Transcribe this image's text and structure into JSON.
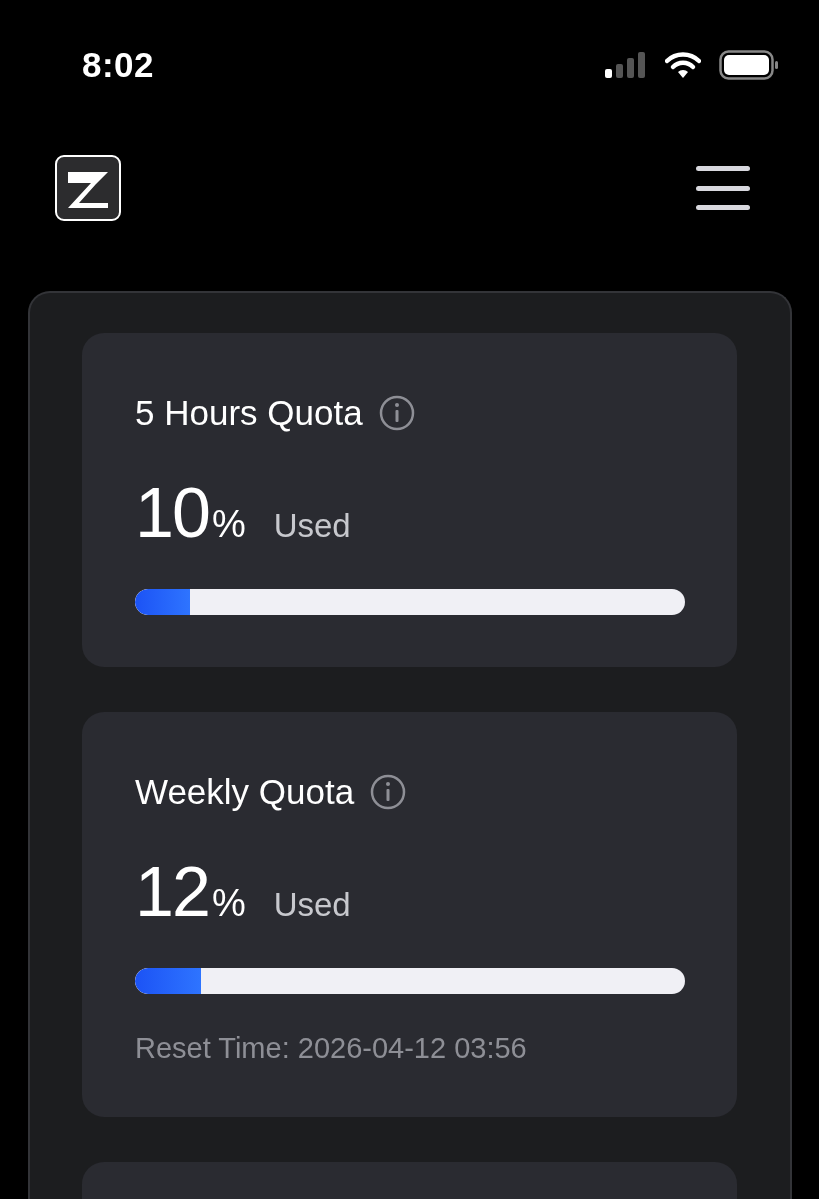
{
  "status_bar": {
    "time": "8:02"
  },
  "quotas": [
    {
      "title": "5 Hours Quota",
      "value": "10",
      "unit": "%",
      "caption": "Used",
      "level": 0.1
    },
    {
      "title": "Weekly Quota",
      "value": "12",
      "unit": "%",
      "caption": "Used",
      "level": 0.12,
      "reset": "Reset Time: 2026-04-12 03:56"
    }
  ]
}
